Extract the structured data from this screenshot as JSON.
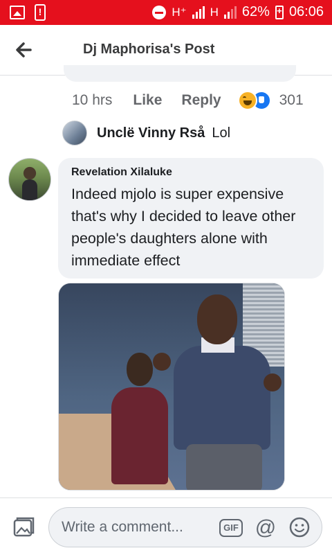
{
  "status_bar": {
    "network_1": "H⁺",
    "network_2": "H",
    "battery": "62%",
    "time": "06:06"
  },
  "header": {
    "title": "Dj Maphorisa's Post"
  },
  "prev_comment_actions": {
    "time": "10 hrs",
    "like": "Like",
    "reply": "Reply",
    "reaction_count": "301",
    "reactions": [
      "haha-icon",
      "like-icon"
    ]
  },
  "reply": {
    "author": "Unclë Vinny Rså",
    "text": "Lol"
  },
  "comment": {
    "author": "Revelation Xilaluke",
    "text": "Indeed mjolo is super expensive that's why I decided to leave other people's daughters alone with immediate effect",
    "has_photo": true
  },
  "composer": {
    "placeholder": "Write a comment...",
    "gif_label": "GIF",
    "at_label": "@"
  },
  "colors": {
    "status_bar": "#e5101d",
    "bubble": "#f0f2f5",
    "muted_text": "#65676b",
    "like_blue": "#1877f2"
  }
}
